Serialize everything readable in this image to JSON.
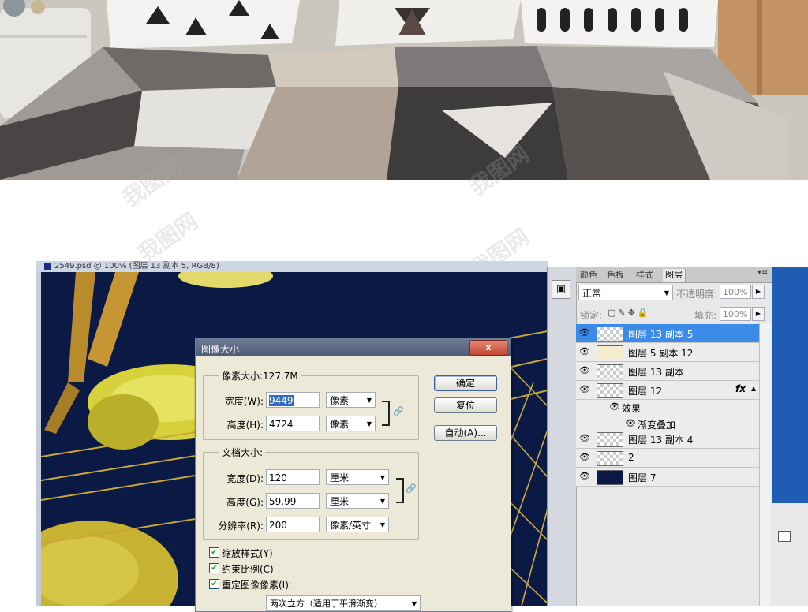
{
  "canvas_title": "2549.psd @ 100% (图层 13 副本 5, RGB/8)",
  "dialog": {
    "title": "图像大小",
    "close": "x",
    "pixel_group": "像素大小:127.7M",
    "width_label": "宽度(W):",
    "width_value": "9449",
    "width_unit": "像素",
    "height_label": "高度(H):",
    "height_value": "4724",
    "height_unit": "像素",
    "doc_group": "文档大小:",
    "doc_width_label": "宽度(D):",
    "doc_width_value": "120",
    "doc_width_unit": "厘米",
    "doc_height_label": "高度(G):",
    "doc_height_value": "59.99",
    "doc_height_unit": "厘米",
    "res_label": "分辨率(R):",
    "res_value": "200",
    "res_unit": "像素/英寸",
    "ok": "确定",
    "reset": "复位",
    "auto": "自动(A)...",
    "scale_styles": "缩放样式(Y)",
    "constrain": "约束比例(C)",
    "resample": "重定图像像素(I):",
    "resample_method": "两次立方（适用于平滑渐变）"
  },
  "panel": {
    "tabs": [
      "颜色",
      "色板",
      "样式",
      "图层"
    ],
    "active_tab": "图层",
    "blend_mode": "正常",
    "opacity_label": "不透明度:",
    "opacity_value": "100%",
    "lock_label": "锁定:",
    "fill_label": "填充:",
    "fill_value": "100%",
    "layers": [
      {
        "name": "图层 13 副本 5",
        "selected": true
      },
      {
        "name": "图层 5 副本 12"
      },
      {
        "name": "图层 13 副本"
      },
      {
        "name": "图层 12",
        "fx": "fx"
      },
      {
        "name": "效果",
        "sub": true
      },
      {
        "name": "渐变叠加",
        "sub2": true
      },
      {
        "name": "图层 13 副本 4"
      },
      {
        "name": "2"
      },
      {
        "name": "图层 7",
        "dark": true
      }
    ]
  },
  "colors": {
    "canvas_bg": "#0b1a44",
    "gold": "#d8b23a",
    "selection": "#3a8ce8"
  },
  "icons": [
    "eye-icon",
    "close-icon",
    "link-chain-icon",
    "fx-icon",
    "camera-icon",
    "dropdown-arrow-icon",
    "checkbox-check-icon"
  ]
}
